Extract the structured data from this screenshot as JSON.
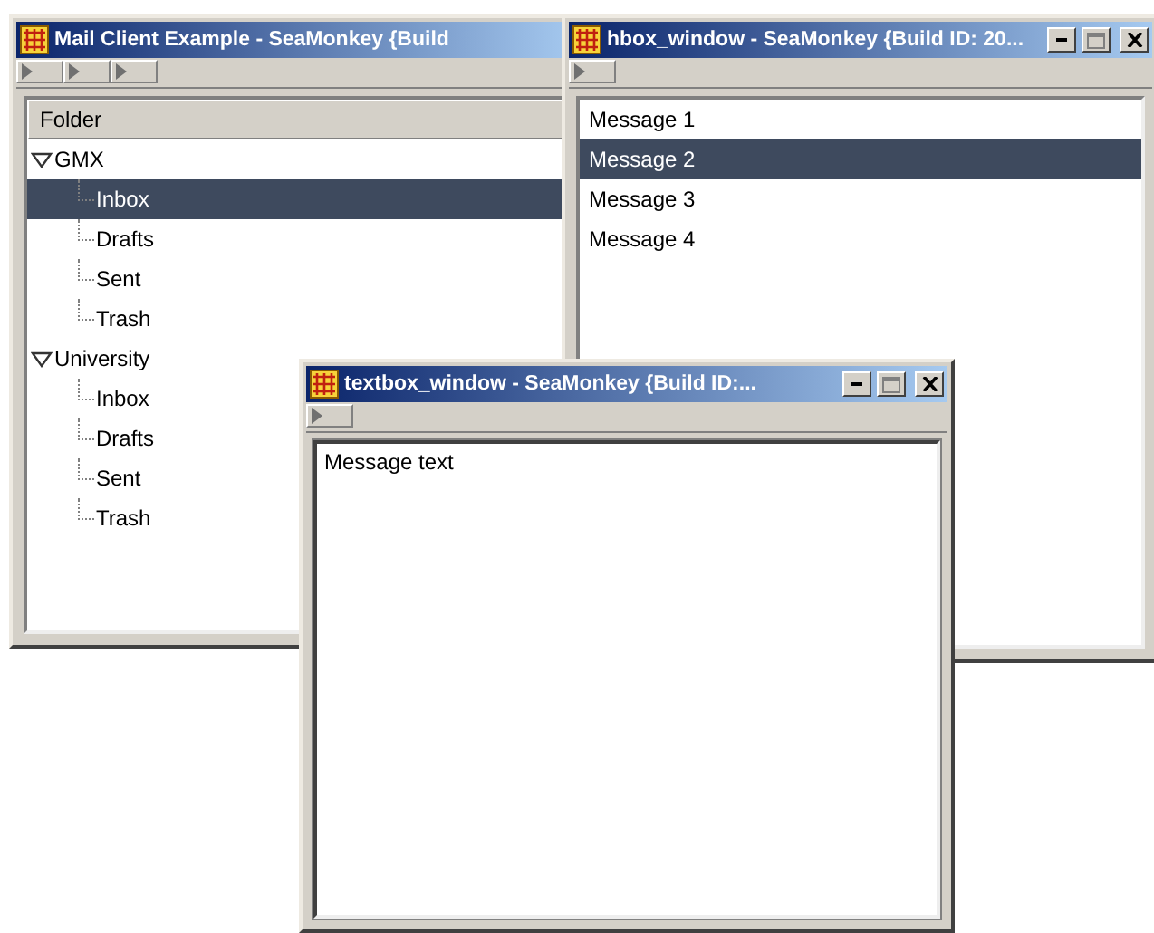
{
  "windows": [
    {
      "kind": "tree",
      "title": "Mail Client Example - SeaMonkey {Build",
      "controls_visible": false,
      "toolbar": [
        {
          "kind": "grippy"
        },
        {
          "kind": "grippy"
        },
        {
          "kind": "grippy"
        }
      ],
      "tree": {
        "header": "Folder",
        "items": [
          {
            "label": "GMX",
            "expanded": true,
            "selected": false,
            "children": [
              {
                "label": "Inbox",
                "selected": true
              },
              {
                "label": "Drafts",
                "selected": false
              },
              {
                "label": "Sent",
                "selected": false
              },
              {
                "label": "Trash",
                "selected": false
              }
            ]
          },
          {
            "label": "University",
            "expanded": true,
            "selected": false,
            "children": [
              {
                "label": "Inbox",
                "selected": false
              },
              {
                "label": "Drafts",
                "selected": false
              },
              {
                "label": "Sent",
                "selected": false
              },
              {
                "label": "Trash",
                "selected": false
              }
            ]
          }
        ]
      }
    },
    {
      "kind": "list",
      "title": "hbox_window - SeaMonkey {Build ID: 20...",
      "controls_visible": true,
      "toolbar": [
        {
          "kind": "grippy"
        }
      ],
      "list": [
        {
          "label": "Message 1",
          "selected": false
        },
        {
          "label": "Message 2",
          "selected": true
        },
        {
          "label": "Message 3",
          "selected": false
        },
        {
          "label": "Message 4",
          "selected": false
        }
      ]
    },
    {
      "kind": "textbox",
      "title": "textbox_window - SeaMonkey {Build ID:...",
      "controls_visible": true,
      "toolbar": [
        {
          "kind": "grippy"
        }
      ],
      "textbox": {
        "value": "Message text"
      }
    }
  ]
}
